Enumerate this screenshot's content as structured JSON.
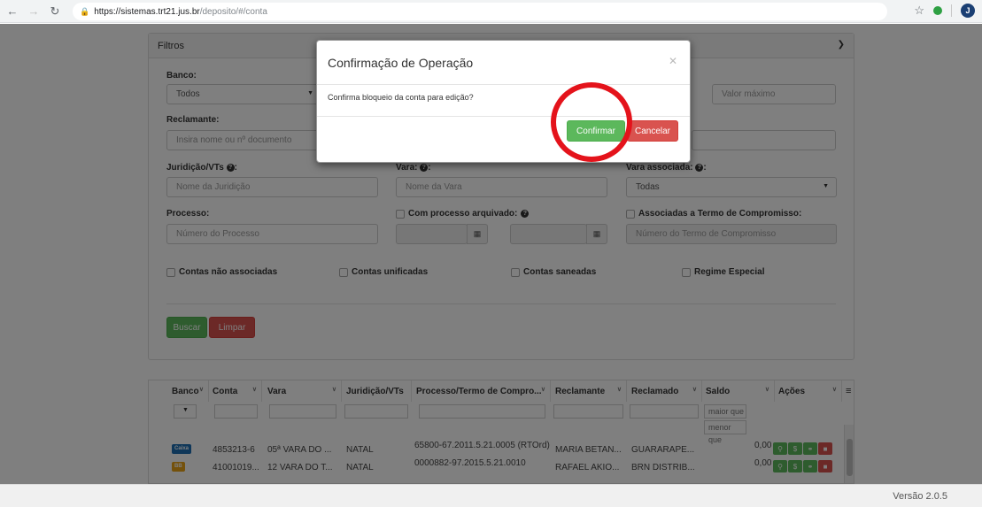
{
  "browser": {
    "url_host": "https://sistemas.trt21.jus.br",
    "url_path": "/deposito/#/conta",
    "profile_initial": "J"
  },
  "filters": {
    "panel_title": "Filtros",
    "banco_label": "Banco:",
    "banco_value": "Todos",
    "valor_max_placeholder": "Valor máximo",
    "reclamante_label": "Reclamante:",
    "reclamante_placeholder": "Insira nome ou nº documento",
    "jurisdicao_label": "Juridição/VTs",
    "jurisdicao_placeholder": "Nome da Juridição",
    "vara_label": "Vara:",
    "vara_placeholder": "Nome da Vara",
    "vara_assoc_label": "Vara associada:",
    "vara_assoc_value": "Todas",
    "processo_label": "Processo:",
    "processo_placeholder": "Número do Processo",
    "arquivado_label": "Com processo arquivado:",
    "termo_label": "Associadas a Termo de Compromisso:",
    "termo_placeholder": "Número do Termo de Compromisso",
    "chk_nao_assoc": "Contas não associadas",
    "chk_unificadas": "Contas unificadas",
    "chk_saneadas": "Contas saneadas",
    "chk_regime": "Regime Especial",
    "buscar_label": "Buscar",
    "limpar_label": "Limpar"
  },
  "table": {
    "headers": [
      "Banco",
      "Conta",
      "Vara",
      "Juridição/VTs",
      "Processo/Termo de Compro...",
      "Reclamante",
      "Reclamado",
      "Saldo",
      "Ações"
    ],
    "saldo_min_placeholder": "maior que",
    "saldo_max_placeholder": "menor que",
    "rows": [
      {
        "banco": "Caixa",
        "conta": "4853213-6",
        "vara": "05ª VARA DO ...",
        "juris": "NATAL",
        "processo": "65800-67.2011.5.21.0005 (RTOrd)",
        "reclamante": "MARIA BETAN...",
        "reclamado": "GUARARAPE...",
        "saldo": "0,00"
      },
      {
        "banco": "BB",
        "conta": "41001019...",
        "vara": "12 VARA DO T...",
        "juris": "NATAL",
        "processo": "0000882-97.2015.5.21.0010",
        "reclamante": "RAFAEL AKIO...",
        "reclamado": "BRN DISTRIB...",
        "saldo": "0,00"
      }
    ]
  },
  "footer": {
    "version": "Versão 2.0.5"
  },
  "modal": {
    "title": "Confirmação de Operação",
    "message": "Confirma bloqueio da conta para edição?",
    "confirm_label": "Confirmar",
    "cancel_label": "Cancelar"
  },
  "colors": {
    "green": "#5cb85c",
    "red": "#d9534f",
    "highlight_ring": "#e4131b",
    "caixa_badge": "#1f6fb2",
    "bb_badge": "#e8a317"
  }
}
